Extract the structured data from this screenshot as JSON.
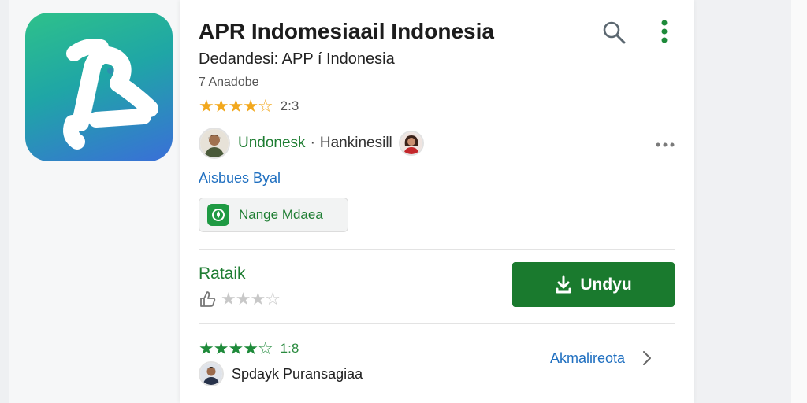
{
  "app": {
    "title": "APR Indomesiaail Indonesia",
    "subtitle": "Dedandesi: APP í Indonesia",
    "meta": "7 Anadobe",
    "rating_value": "2:3",
    "rating_stars": 3.5,
    "icon_name": "app-logo-icon",
    "icon_colors": [
      "#2ec18a",
      "#1fa6a6",
      "#3a6fd8"
    ]
  },
  "toolbar": {
    "search_icon": "search-icon",
    "more_icon": "more-vert-icon"
  },
  "developer": {
    "name": "Undonesk",
    "separator": "·",
    "secondary": "Hankinesill",
    "more_icon": "more-horiz-icon"
  },
  "link": {
    "text": "Aisbues Byal"
  },
  "tag": {
    "label": "Nange Mdaea",
    "icon": "leaf-icon"
  },
  "rate_section": {
    "title": "Rataik",
    "stars": 0
  },
  "install": {
    "label": "Undyu",
    "icon": "download-icon",
    "color": "#1a7a2e"
  },
  "review": {
    "stars": 4.5,
    "rating_value": "1:8",
    "reviewer_name": "Spdayk Puransagiaa",
    "see_more_label": "Akmalireota",
    "see_more_icon": "chevron-right-icon"
  },
  "colors": {
    "accent_green": "#1e7d32",
    "link_blue": "#1f6fc0",
    "star_gold": "#f2a81d"
  }
}
